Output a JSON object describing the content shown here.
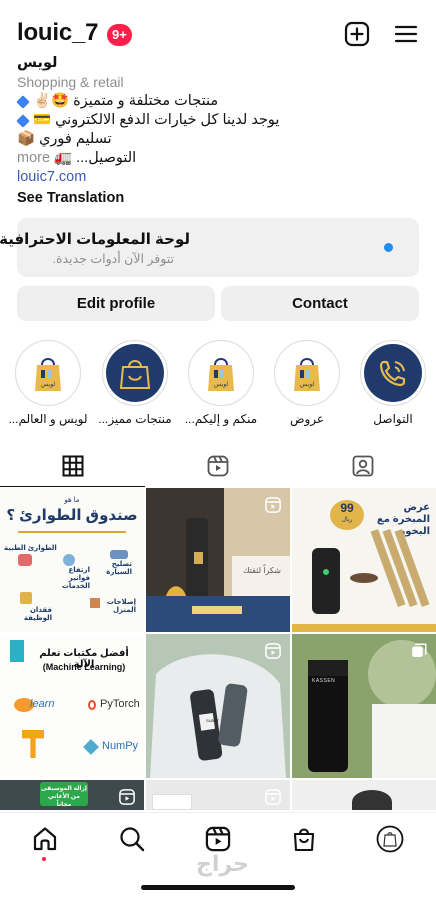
{
  "header": {
    "username": "louic_7",
    "notification_badge": "9+",
    "create_icon": "plus-square-icon",
    "menu_icon": "hamburger-menu-icon"
  },
  "bio": {
    "name": "لويس",
    "category": "Shopping & retail",
    "lines": [
      "منتجات مختلفة و متميزة 🤩✌🏻",
      "يوجد لدينا كل خيارات الدفع الالكتروني 💳",
      "تسليم فوري 📦"
    ],
    "truncated_line": "التوصيل... 🚛",
    "more_label": "more",
    "link": "louic7.com",
    "translate_label": "See Translation"
  },
  "professional_dashboard": {
    "title": "لوحة المعلومات الاحترافية",
    "subtitle": "تتوفر الآن أدوات جديدة.",
    "dot_color": "#1d8ef0"
  },
  "actions": {
    "edit_label": "Edit profile",
    "contact_label": "Contact"
  },
  "highlights": [
    {
      "label": "لويس و العالم..."
    },
    {
      "label": "منتجات مميز..."
    },
    {
      "label": "منكم و إليكم..."
    },
    {
      "label": "عروض"
    },
    {
      "label": "التواصل"
    }
  ],
  "tabs": [
    {
      "icon": "grid-icon",
      "active": true
    },
    {
      "icon": "reels-icon",
      "active": false
    },
    {
      "icon": "tagged-user-icon",
      "active": false
    }
  ],
  "posts": [
    {
      "title": "صندوق الطوارئ ؟",
      "kicker": "ما هو",
      "items": [
        "الطوارئ الطبية",
        "ارتفاع فواتير الخدمات",
        "تصليح السيارة",
        "إصلاحات المنزل",
        "فقدان الوظيفة"
      ]
    },
    {
      "caption": "شكراً لثقتك"
    },
    {
      "title": "عرض المبخرة مع البخور",
      "price": "99",
      "currency": "ريال"
    },
    {
      "title": "أفضل مكتبات تعلم الآلة",
      "subtitle": "(Machine Learning)",
      "libraries": [
        "learn",
        "PyTorch",
        "NumPy"
      ]
    },
    {
      "brand": "SUBAT"
    },
    {
      "brand": "KASSEN"
    },
    {
      "caption": "إزالة الموسيقى من الأغاني مجاناً"
    },
    {},
    {}
  ],
  "bottom_nav": [
    {
      "icon": "home-icon"
    },
    {
      "icon": "search-icon"
    },
    {
      "icon": "reels-icon"
    },
    {
      "icon": "shop-icon"
    },
    {
      "icon": "profile-avatar-icon"
    }
  ],
  "watermark": "حراج",
  "colors": {
    "badge": "#ff1f4b",
    "link": "#3b5bab",
    "gold": "#d8a632",
    "navy": "#1f3a6b"
  }
}
